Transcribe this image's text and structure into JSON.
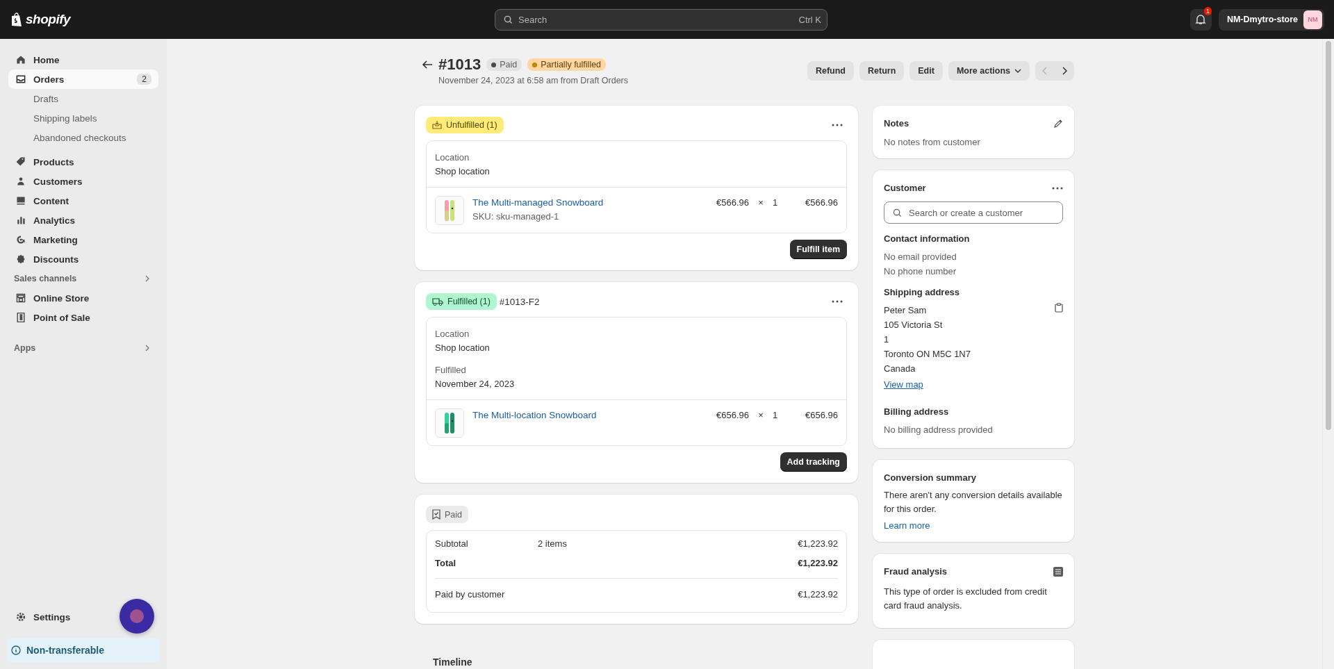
{
  "topbar": {
    "logo": "shopify",
    "search": {
      "placeholder": "Search",
      "shortcut": "Ctrl K"
    },
    "notifications": {
      "count": "1"
    },
    "store": {
      "name": "NM-Dmytro-store",
      "initials": "NM"
    }
  },
  "sidebar": {
    "items": [
      {
        "label": "Home",
        "selected": false
      },
      {
        "label": "Orders",
        "selected": true,
        "badge": "2",
        "children": [
          {
            "label": "Drafts",
            "selected": false
          },
          {
            "label": "Shipping labels",
            "selected": false
          },
          {
            "label": "Abandoned checkouts",
            "selected": false
          }
        ]
      },
      {
        "label": "Products",
        "selected": false
      },
      {
        "label": "Customers",
        "selected": false
      },
      {
        "label": "Content",
        "selected": false
      },
      {
        "label": "Analytics",
        "selected": false
      },
      {
        "label": "Marketing",
        "selected": false
      },
      {
        "label": "Discounts",
        "selected": false
      }
    ],
    "sections": [
      {
        "title": "Sales channels",
        "items": [
          {
            "label": "Online Store",
            "selected": false
          },
          {
            "label": "Point of Sale",
            "selected": false
          }
        ]
      },
      {
        "title": "Apps"
      }
    ],
    "settings": "Settings",
    "notice": "Non-transferable"
  },
  "order": {
    "title": "#1013",
    "badges": [
      {
        "label": "Paid",
        "kind": "payment"
      },
      {
        "label": "Partially fulfilled",
        "kind": "fulfillment"
      }
    ],
    "subtitle": "November 24, 2023 at 6:58 am from Draft Orders",
    "actions": [
      "Refund",
      "Return",
      "Edit",
      "More actions"
    ],
    "pager": {
      "previous": {
        "disabled": true
      },
      "next": {
        "disabled": false
      }
    }
  },
  "fulfillments": [
    {
      "kind": "unfulfilled",
      "status": "Unfulfilled (1)",
      "location_label": "Location",
      "location": "Shop location",
      "items": [
        {
          "name": "The Multi-managed Snowboard",
          "sku": "SKU: sku-managed-1",
          "price": "€566.96",
          "times": "×",
          "qty": "1",
          "total": "€566.96"
        }
      ],
      "action": "Fulfill item"
    },
    {
      "kind": "fulfilled",
      "status": "Fulfilled (1)",
      "number": "#1013-F2",
      "location_label": "Location",
      "location": "Shop location",
      "date_label": "Fulfilled",
      "date": "November 24, 2023",
      "items": [
        {
          "name": "The Multi-location Snowboard",
          "price": "€656.96",
          "times": "×",
          "qty": "1",
          "total": "€656.96"
        }
      ],
      "action": "Add tracking"
    }
  ],
  "payment": {
    "status": "Paid",
    "rows": [
      {
        "kind": "normal",
        "label": "Subtotal",
        "detail": "2 items",
        "amount": "€1,223.92"
      },
      {
        "kind": "total",
        "label": "Total",
        "amount": "€1,223.92"
      },
      {
        "kind": "paid",
        "label": "Paid by customer",
        "amount": "€1,223.92"
      }
    ]
  },
  "timeline": {
    "title": "Timeline"
  },
  "notes": {
    "title": "Notes",
    "text": "No notes from customer"
  },
  "customer": {
    "title": "Customer",
    "search_placeholder": "Search or create a customer",
    "contact_title": "Contact information",
    "contact": [
      "No email provided",
      "No phone number"
    ],
    "shipping_title": "Shipping address",
    "address": [
      "Peter Sam",
      "105 Victoria St",
      "1",
      "Toronto ON M5C 1N7",
      "Canada"
    ],
    "map_link": "View map",
    "billing_title": "Billing address",
    "billing_text": "No billing address provided"
  },
  "conversion": {
    "title": "Conversion summary",
    "text": "There aren't any conversion details available for this order.",
    "link": "Learn more"
  },
  "fraud": {
    "title": "Fraud analysis",
    "text": "This type of order is excluded from credit card fraud analysis."
  }
}
